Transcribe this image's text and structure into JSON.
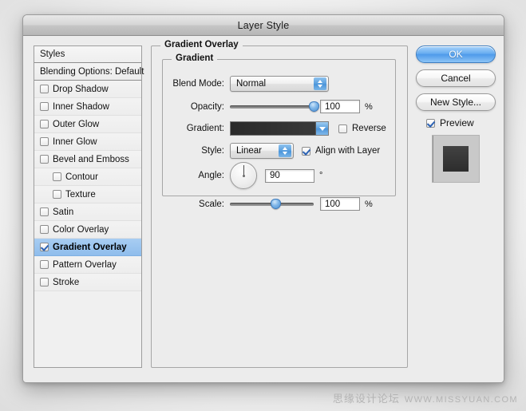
{
  "window": {
    "title": "Layer Style"
  },
  "sidebar": {
    "header": "Styles",
    "blending_options": "Blending Options: Default",
    "items": [
      {
        "label": "Drop Shadow",
        "checked": false,
        "selected": false,
        "indent": false
      },
      {
        "label": "Inner Shadow",
        "checked": false,
        "selected": false,
        "indent": false
      },
      {
        "label": "Outer Glow",
        "checked": false,
        "selected": false,
        "indent": false
      },
      {
        "label": "Inner Glow",
        "checked": false,
        "selected": false,
        "indent": false
      },
      {
        "label": "Bevel and Emboss",
        "checked": false,
        "selected": false,
        "indent": false
      },
      {
        "label": "Contour",
        "checked": false,
        "selected": false,
        "indent": true
      },
      {
        "label": "Texture",
        "checked": false,
        "selected": false,
        "indent": true
      },
      {
        "label": "Satin",
        "checked": false,
        "selected": false,
        "indent": false
      },
      {
        "label": "Color Overlay",
        "checked": false,
        "selected": false,
        "indent": false
      },
      {
        "label": "Gradient Overlay",
        "checked": true,
        "selected": true,
        "indent": false
      },
      {
        "label": "Pattern Overlay",
        "checked": false,
        "selected": false,
        "indent": false
      },
      {
        "label": "Stroke",
        "checked": false,
        "selected": false,
        "indent": false
      }
    ]
  },
  "main": {
    "panel_title": "Gradient Overlay",
    "group_title": "Gradient",
    "blend_mode": {
      "label": "Blend Mode:",
      "value": "Normal"
    },
    "opacity": {
      "label": "Opacity:",
      "value": "100",
      "unit": "%",
      "percent": 100
    },
    "gradient": {
      "label": "Gradient:",
      "from_color": "#2a2a2a",
      "to_color": "#3c3c3c"
    },
    "reverse": {
      "label": "Reverse",
      "checked": false
    },
    "style": {
      "label": "Style:",
      "value": "Linear"
    },
    "align_with_layer": {
      "label": "Align with Layer",
      "checked": true
    },
    "angle": {
      "label": "Angle:",
      "value": "90",
      "unit": "°",
      "degrees": 90
    },
    "scale": {
      "label": "Scale:",
      "value": "100",
      "unit": "%",
      "percent": 55
    }
  },
  "buttons": {
    "ok": "OK",
    "cancel": "Cancel",
    "new_style": "New Style...",
    "preview": {
      "label": "Preview",
      "checked": true
    }
  },
  "preview_thumb": {
    "background": "#c9c9c9",
    "swatch_from": "#424242",
    "swatch_to": "#2d2d2d"
  },
  "watermark": {
    "chinese": "思缘设计论坛",
    "url": "WWW.MISSYUAN.COM"
  }
}
